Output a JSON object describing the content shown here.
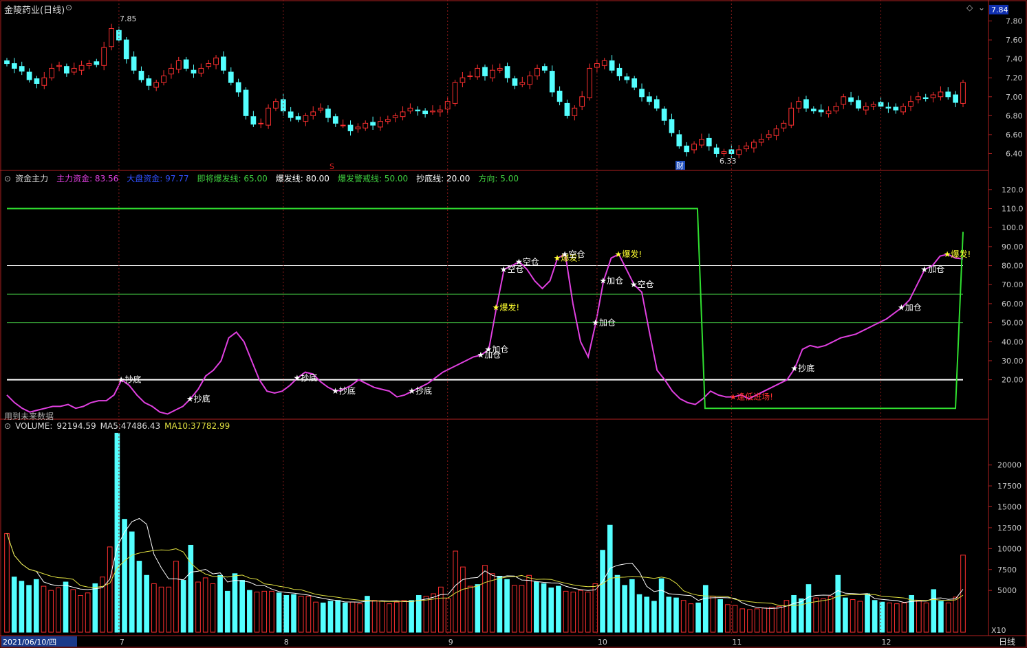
{
  "app": {
    "stock_title": "金陵药业(日线)",
    "price_badge": "7.84",
    "period_label": "日线",
    "zoom_label": "X10",
    "date_label": "2021/06/10/四"
  },
  "panels": {
    "price": {
      "y_ticks": [
        "7.80",
        "7.60",
        "7.40",
        "7.20",
        "7.00",
        "6.80",
        "6.60",
        "6.40"
      ],
      "high_label": "7.85",
      "low_label": "6.33",
      "marker_s": "S",
      "marker_cai": "财"
    },
    "indicator": {
      "name": "资金主力",
      "note": "用到未来数据",
      "legend": [
        {
          "label": "主力资金:",
          "value": "83.56",
          "color": "#e040e0"
        },
        {
          "label": "大盘资金:",
          "value": "97.77",
          "color": "#3050ff"
        },
        {
          "label": "即将爆发线:",
          "value": "65.00",
          "color": "#40d040"
        },
        {
          "label": "爆发线:",
          "value": "80.00",
          "color": "#ffffff"
        },
        {
          "label": "爆发警戒线:",
          "value": "50.00",
          "color": "#40d040"
        },
        {
          "label": "抄底线:",
          "value": "20.00",
          "color": "#ffffff"
        },
        {
          "label": "方向:",
          "value": "5.00",
          "color": "#40d040"
        }
      ],
      "y_ticks": [
        "120.0",
        "110.0",
        "100.0",
        "90.00",
        "80.00",
        "70.00",
        "60.00",
        "50.00",
        "40.00",
        "30.00",
        "20.00"
      ],
      "signals": {
        "buy_dip": "抄底",
        "add": "加仓",
        "empty": "空仓",
        "burst": "爆发!",
        "low_enter": "逢低进场!"
      }
    },
    "volume": {
      "name": "VOLUME",
      "vol": "92194.59",
      "ma5_label": "MA5:",
      "ma5": "47486.43",
      "ma10_label": "MA10:",
      "ma10": "37782.99",
      "y_ticks": [
        "20000",
        "17500",
        "15000",
        "12500",
        "10000",
        "7500",
        "5000"
      ]
    }
  },
  "x_axis": {
    "months": [
      "7",
      "8",
      "9",
      "10",
      "11",
      "12"
    ]
  },
  "chart_data": [
    {
      "type": "candlestick",
      "title": "金陵药业(日线)",
      "ylim": [
        6.28,
        7.92
      ],
      "close": [
        7.35,
        7.3,
        7.27,
        7.18,
        7.14,
        7.2,
        7.3,
        7.33,
        7.25,
        7.3,
        7.33,
        7.35,
        7.34,
        7.52,
        7.72,
        7.6,
        7.4,
        7.28,
        7.18,
        7.12,
        7.15,
        7.22,
        7.3,
        7.38,
        7.3,
        7.25,
        7.3,
        7.35,
        7.41,
        7.28,
        7.15,
        7.05,
        6.8,
        6.71,
        6.72,
        6.88,
        6.95,
        6.85,
        6.78,
        6.76,
        6.8,
        6.84,
        6.88,
        6.78,
        6.72,
        6.7,
        6.64,
        6.68,
        6.72,
        6.7,
        6.74,
        6.76,
        6.8,
        6.84,
        6.88,
        6.85,
        6.82,
        6.85,
        6.86,
        6.95,
        7.15,
        7.2,
        7.22,
        7.3,
        7.22,
        7.28,
        7.3,
        7.2,
        7.12,
        7.15,
        7.22,
        7.3,
        7.28,
        7.05,
        6.95,
        6.8,
        6.88,
        7.0,
        7.3,
        7.35,
        7.38,
        7.28,
        7.22,
        7.18,
        7.1,
        7.0,
        6.95,
        6.88,
        6.75,
        6.62,
        6.48,
        6.42,
        6.5,
        6.55,
        6.48,
        6.4,
        6.42,
        6.4,
        6.44,
        6.48,
        6.52,
        6.55,
        6.6,
        6.66,
        6.72,
        6.88,
        6.95,
        6.88,
        6.85,
        6.84,
        6.85,
        6.9,
        7.0,
        6.95,
        6.88,
        6.9,
        6.92,
        6.9,
        6.88,
        6.86,
        6.9,
        6.95,
        7.0,
        6.98,
        7.02,
        7.05,
        7.0,
        6.94,
        7.15
      ],
      "ma_note": "daily candles, rise = red hollow, fall = cyan filled"
    },
    {
      "type": "line",
      "title": "资金主力",
      "ylim": [
        0,
        125
      ],
      "series": [
        {
          "name": "主力资金",
          "values": [
            12,
            8,
            5,
            3,
            4,
            5,
            6,
            6,
            7,
            5,
            6,
            8,
            9,
            9,
            12,
            20,
            17,
            12,
            8,
            6,
            3,
            2,
            4,
            6,
            10,
            15,
            22,
            25,
            30,
            42,
            45,
            40,
            30,
            20,
            14,
            13,
            14,
            17,
            21,
            24,
            23,
            19,
            16,
            14,
            15,
            17,
            20,
            18,
            16,
            15,
            14,
            11,
            12,
            14,
            16,
            18,
            21,
            24,
            26,
            28,
            30,
            32,
            33,
            36,
            58,
            78,
            80,
            82,
            78,
            72,
            68,
            72,
            84,
            86,
            60,
            40,
            32,
            50,
            72,
            84,
            86,
            78,
            70,
            66,
            45,
            25,
            20,
            14,
            10,
            8,
            7,
            10,
            14,
            12,
            11,
            11,
            12,
            10,
            12,
            14,
            16,
            18,
            20,
            26,
            36,
            38,
            37,
            38,
            40,
            42,
            43,
            44,
            46,
            48,
            50,
            52,
            55,
            58,
            62,
            70,
            78,
            80,
            85,
            86,
            84,
            83.56
          ]
        },
        {
          "name": "大盘资金",
          "values": [
            110,
            110,
            110,
            110,
            110,
            110,
            110,
            110,
            110,
            110,
            110,
            110,
            110,
            110,
            110,
            110,
            110,
            110,
            110,
            110,
            110,
            110,
            110,
            110,
            110,
            110,
            110,
            110,
            110,
            110,
            110,
            110,
            110,
            110,
            110,
            110,
            110,
            110,
            110,
            110,
            110,
            110,
            110,
            110,
            110,
            110,
            110,
            110,
            110,
            110,
            110,
            110,
            110,
            110,
            110,
            110,
            110,
            110,
            110,
            110,
            110,
            110,
            110,
            110,
            110,
            110,
            110,
            110,
            110,
            110,
            110,
            110,
            110,
            110,
            110,
            110,
            110,
            110,
            110,
            110,
            110,
            110,
            110,
            110,
            110,
            110,
            110,
            110,
            110,
            110,
            110,
            110,
            5,
            5,
            5,
            5,
            5,
            5,
            5,
            5,
            5,
            5,
            5,
            5,
            5,
            5,
            5,
            5,
            5,
            5,
            5,
            5,
            5,
            5,
            5,
            5,
            5,
            5,
            5,
            5,
            5,
            5,
            5,
            5,
            5,
            5,
            97.77
          ]
        }
      ],
      "hlines": [
        80,
        65,
        50,
        20
      ]
    },
    {
      "type": "bar",
      "title": "VOLUME",
      "ylim": [
        0,
        24000
      ],
      "values": [
        11800,
        6600,
        6100,
        5600,
        6300,
        5500,
        5000,
        5300,
        6000,
        5100,
        4400,
        4700,
        5800,
        6600,
        10200,
        23800,
        13500,
        12000,
        8500,
        6800,
        5800,
        5400,
        5400,
        8500,
        6200,
        10400,
        6000,
        6500,
        5800,
        6800,
        4900,
        7000,
        6200,
        5000,
        4800,
        4900,
        4900,
        4700,
        4400,
        4500,
        4300,
        4300,
        3600,
        3500,
        3700,
        3800,
        3500,
        3600,
        3400,
        4300,
        3800,
        3700,
        3400,
        3600,
        3800,
        3800,
        4400,
        4300,
        4600,
        5400,
        4000,
        9700,
        7800,
        5500,
        5700,
        8000,
        7000,
        6700,
        6300,
        5600,
        5600,
        6800,
        6000,
        5800,
        5300,
        5500,
        4900,
        4800,
        5000,
        4800,
        5800,
        9800,
        12800,
        6800,
        5600,
        6300,
        4500,
        4200,
        3700,
        6400,
        4200,
        4100,
        3800,
        3400,
        3500,
        5600,
        4300,
        3900,
        3300,
        3200,
        2800,
        2700,
        2800,
        2900,
        3000,
        3100,
        3800,
        4400,
        4000,
        5700,
        4100,
        4000,
        4300,
        6800,
        4100,
        3900,
        3700,
        4600,
        3800,
        3600,
        3500,
        3400,
        3500,
        4400,
        3800,
        3500,
        5100,
        3700,
        3500,
        4200,
        9219
      ],
      "series_lines": [
        "MA5",
        "MA10"
      ]
    }
  ]
}
